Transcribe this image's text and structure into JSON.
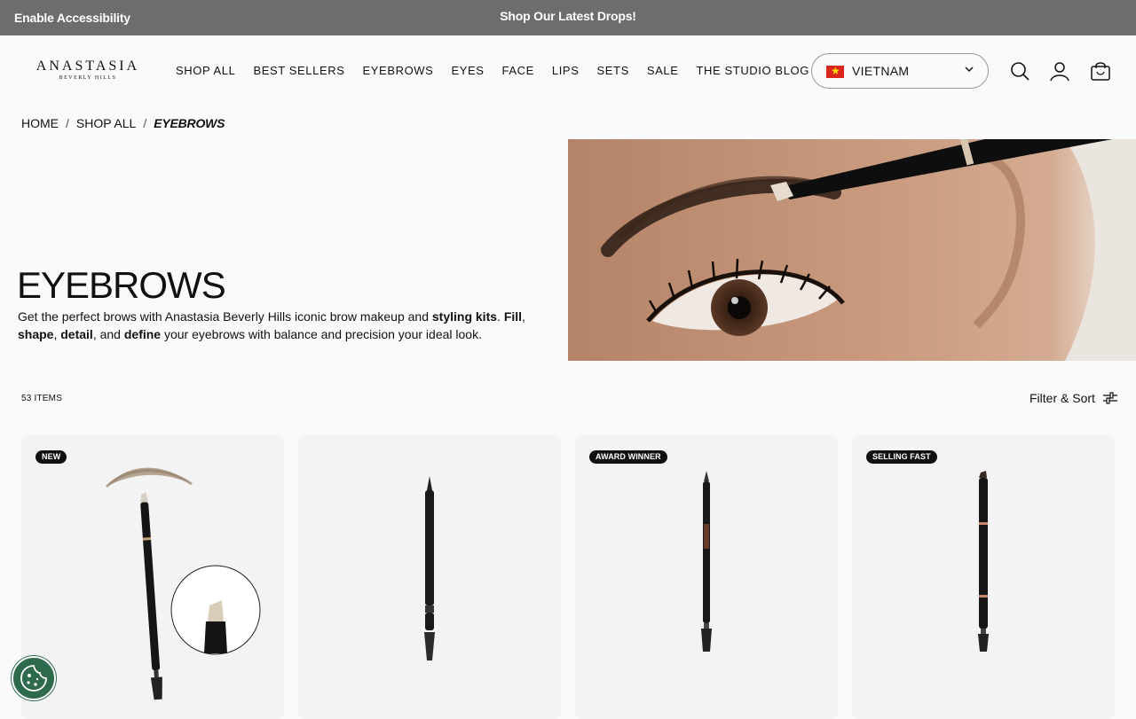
{
  "topbar": {
    "accessibility": "Enable Accessibility",
    "promo": "Shop Our Latest Drops!"
  },
  "logo": {
    "main": "ANASTASIA",
    "sub": "BEVERLY HILLS"
  },
  "nav": [
    "SHOP ALL",
    "BEST SELLERS",
    "EYEBROWS",
    "EYES",
    "FACE",
    "LIPS",
    "SETS",
    "SALE",
    "THE STUDIO BLOG"
  ],
  "country": {
    "name": "VIETNAM",
    "flag_icon": "vietnam-flag-icon"
  },
  "icons": [
    "search-icon",
    "account-icon",
    "bag-icon"
  ],
  "breadcrumb": {
    "home": "HOME",
    "shop_all": "SHOP ALL",
    "current": "EYEBROWS",
    "sep": "/"
  },
  "hero": {
    "title": "EYEBROWS",
    "desc_parts": [
      "Get the perfect brows with Anastasia Beverly Hills iconic brow makeup and ",
      "styling kits",
      ". ",
      "Fill",
      ", ",
      "shape",
      ", ",
      "detail",
      ", and ",
      "define",
      " your eyebrows with balance and precision your ideal look."
    ]
  },
  "listing": {
    "count": "53 ITEMS",
    "filter_label": "Filter & Sort"
  },
  "products": [
    {
      "badge": "NEW"
    },
    {
      "badge": ""
    },
    {
      "badge": "AWARD WINNER"
    },
    {
      "badge": "SELLING FAST"
    }
  ],
  "colors": {
    "topbar": "#6d6d6d",
    "background": "#fafafa",
    "card": "#f3f3f3",
    "cookie": "#2e6b4d"
  }
}
